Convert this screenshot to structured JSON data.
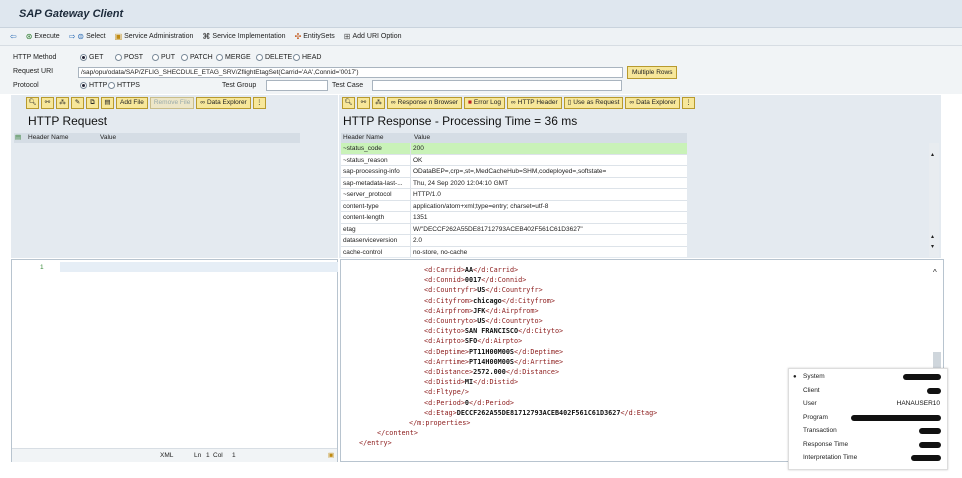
{
  "app": {
    "title": "SAP Gateway Client"
  },
  "toolbar": {
    "execute": "Execute",
    "select": "Select",
    "service_admin": "Service Administration",
    "service_impl": "Service Implementation",
    "entity_sets": "EntitySets",
    "add_uri": "Add URI Option"
  },
  "form": {
    "http_method_label": "HTTP Method",
    "methods": [
      "GET",
      "POST",
      "PUT",
      "PATCH",
      "MERGE",
      "DELETE",
      "HEAD"
    ],
    "selected_method": "GET",
    "request_uri_label": "Request URI",
    "request_uri": "/sap/opu/odata/SAP/ZFLIG_SHECDULE_ETAG_SRV/ZflightEtagSet(Carrid='AA',Connid='0017')",
    "multiple_rows": "Multiple Rows",
    "protocol_label": "Protocol",
    "protocols": [
      "HTTP",
      "HTTPS"
    ],
    "test_group_label": "Test Group",
    "test_case_label": "Test Case"
  },
  "request": {
    "title": "HTTP Request",
    "add_file": "Add File",
    "remove_file": "Remove File",
    "data_explorer": "Data Explorer",
    "col_name": "Header Name",
    "col_value": "Value"
  },
  "response": {
    "title": "HTTP Response - Processing Time = 36  ms",
    "resp_browser": "Response n Browser",
    "error_log": "Error Log",
    "http_header": "HTTP Header",
    "use_request": "Use as Request",
    "data_explorer": "Data Explorer",
    "col_name": "Header Name",
    "col_value": "Value",
    "headers": [
      {
        "name": "~status_code",
        "value": "200"
      },
      {
        "name": "~status_reason",
        "value": "OK"
      },
      {
        "name": "sap-processing-info",
        "value": "ODataBEP=,crp=,st=,MedCacheHub=SHM,codeployed=,softstate="
      },
      {
        "name": "sap-metadata-last-...",
        "value": "Thu, 24 Sep 2020 12:04:10 GMT"
      },
      {
        "name": "~server_protocol",
        "value": "HTTP/1.0"
      },
      {
        "name": "content-type",
        "value": "application/atom+xml;type=entry; charset=utf-8"
      },
      {
        "name": "content-length",
        "value": "1351"
      },
      {
        "name": "etag",
        "value": "W/\"DECCF262A55DE81712793ACEB402F561C61D3627\""
      },
      {
        "name": "dataserviceversion",
        "value": "2.0"
      },
      {
        "name": "cache-control",
        "value": "no-store, no-cache"
      }
    ]
  },
  "editor_left": {
    "line_no": "1",
    "status_xml": "XML",
    "status_ln": "Ln",
    "status_ln_val": "1",
    "status_col": "Col",
    "status_col_val": "1"
  },
  "xml_lines": [
    {
      "indent": 0,
      "open": "<d:Carrid>",
      "val": "AA",
      "close": "</d:Carrid>"
    },
    {
      "indent": 0,
      "open": "<d:Connid>",
      "val": "0017",
      "close": "</d:Connid>"
    },
    {
      "indent": 0,
      "open": "<d:Countryfr>",
      "val": "US",
      "close": "</d:Countryfr>"
    },
    {
      "indent": 0,
      "open": "<d:Cityfrom>",
      "val": "chicago",
      "close": "</d:Cityfrom>"
    },
    {
      "indent": 0,
      "open": "<d:Airpfrom>",
      "val": "JFK",
      "close": "</d:Airpfrom>"
    },
    {
      "indent": 0,
      "open": "<d:Countryto>",
      "val": "US",
      "close": "</d:Countryto>"
    },
    {
      "indent": 0,
      "open": "<d:Cityto>",
      "val": "SAN FRANCISCO",
      "close": "</d:Cityto>"
    },
    {
      "indent": 0,
      "open": "<d:Airpto>",
      "val": "SFO",
      "close": "</d:Airpto>"
    },
    {
      "indent": 0,
      "open": "<d:Deptime>",
      "val": "PT11H00M00S",
      "close": "</d:Deptime>"
    },
    {
      "indent": 0,
      "open": "<d:Arrtime>",
      "val": "PT14H00M00S",
      "close": "</d:Arrtime>"
    },
    {
      "indent": 0,
      "open": "<d:Distance>",
      "val": "2572.000",
      "close": "</d:Distance>"
    },
    {
      "indent": 0,
      "open": "<d:Distid>",
      "val": "MI",
      "close": "</d:Distid>"
    },
    {
      "indent": 0,
      "open": "<d:Fltype/>",
      "val": "",
      "close": ""
    },
    {
      "indent": 0,
      "open": "<d:Period>",
      "val": "0",
      "close": "</d:Period>"
    },
    {
      "indent": 0,
      "open": "<d:Etag>",
      "val": "DECCF262A55DE81712793ACEB402F561C61D3627",
      "close": "</d:Etag>"
    },
    {
      "indent": 1,
      "open": "</m:properties>",
      "val": "",
      "close": ""
    },
    {
      "indent": 2,
      "open": "</content>",
      "val": "",
      "close": ""
    },
    {
      "indent": 3,
      "open": "</entry>",
      "val": "",
      "close": ""
    }
  ],
  "system_popup": {
    "items": [
      {
        "label": "System",
        "value": ""
      },
      {
        "label": "Client",
        "value": ""
      },
      {
        "label": "User",
        "value": "HANAUSER10"
      },
      {
        "label": "Program",
        "value": ""
      },
      {
        "label": "Transaction",
        "value": ""
      },
      {
        "label": "Response Time",
        "value": ""
      },
      {
        "label": "Interpretation Time",
        "value": ""
      }
    ]
  }
}
